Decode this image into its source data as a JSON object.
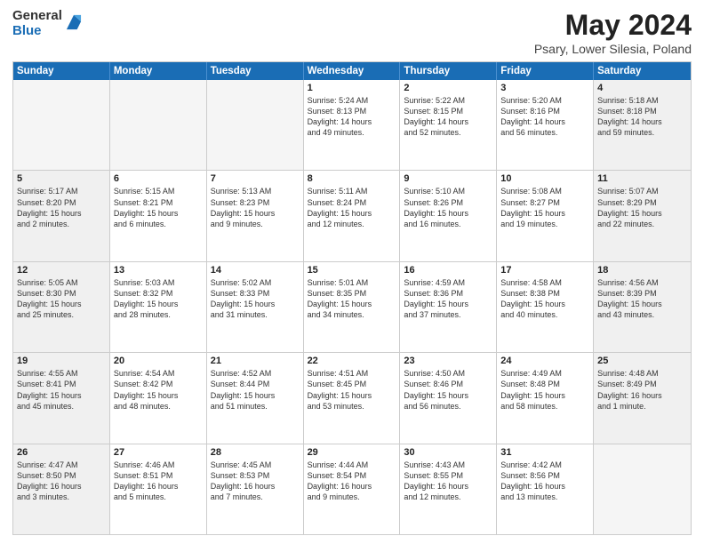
{
  "header": {
    "logo_general": "General",
    "logo_blue": "Blue",
    "title": "May 2024",
    "location": "Psary, Lower Silesia, Poland"
  },
  "days_of_week": [
    "Sunday",
    "Monday",
    "Tuesday",
    "Wednesday",
    "Thursday",
    "Friday",
    "Saturday"
  ],
  "weeks": [
    [
      {
        "day": "",
        "info": ""
      },
      {
        "day": "",
        "info": ""
      },
      {
        "day": "",
        "info": ""
      },
      {
        "day": "1",
        "info": "Sunrise: 5:24 AM\nSunset: 8:13 PM\nDaylight: 14 hours\nand 49 minutes."
      },
      {
        "day": "2",
        "info": "Sunrise: 5:22 AM\nSunset: 8:15 PM\nDaylight: 14 hours\nand 52 minutes."
      },
      {
        "day": "3",
        "info": "Sunrise: 5:20 AM\nSunset: 8:16 PM\nDaylight: 14 hours\nand 56 minutes."
      },
      {
        "day": "4",
        "info": "Sunrise: 5:18 AM\nSunset: 8:18 PM\nDaylight: 14 hours\nand 59 minutes."
      }
    ],
    [
      {
        "day": "5",
        "info": "Sunrise: 5:17 AM\nSunset: 8:20 PM\nDaylight: 15 hours\nand 2 minutes."
      },
      {
        "day": "6",
        "info": "Sunrise: 5:15 AM\nSunset: 8:21 PM\nDaylight: 15 hours\nand 6 minutes."
      },
      {
        "day": "7",
        "info": "Sunrise: 5:13 AM\nSunset: 8:23 PM\nDaylight: 15 hours\nand 9 minutes."
      },
      {
        "day": "8",
        "info": "Sunrise: 5:11 AM\nSunset: 8:24 PM\nDaylight: 15 hours\nand 12 minutes."
      },
      {
        "day": "9",
        "info": "Sunrise: 5:10 AM\nSunset: 8:26 PM\nDaylight: 15 hours\nand 16 minutes."
      },
      {
        "day": "10",
        "info": "Sunrise: 5:08 AM\nSunset: 8:27 PM\nDaylight: 15 hours\nand 19 minutes."
      },
      {
        "day": "11",
        "info": "Sunrise: 5:07 AM\nSunset: 8:29 PM\nDaylight: 15 hours\nand 22 minutes."
      }
    ],
    [
      {
        "day": "12",
        "info": "Sunrise: 5:05 AM\nSunset: 8:30 PM\nDaylight: 15 hours\nand 25 minutes."
      },
      {
        "day": "13",
        "info": "Sunrise: 5:03 AM\nSunset: 8:32 PM\nDaylight: 15 hours\nand 28 minutes."
      },
      {
        "day": "14",
        "info": "Sunrise: 5:02 AM\nSunset: 8:33 PM\nDaylight: 15 hours\nand 31 minutes."
      },
      {
        "day": "15",
        "info": "Sunrise: 5:01 AM\nSunset: 8:35 PM\nDaylight: 15 hours\nand 34 minutes."
      },
      {
        "day": "16",
        "info": "Sunrise: 4:59 AM\nSunset: 8:36 PM\nDaylight: 15 hours\nand 37 minutes."
      },
      {
        "day": "17",
        "info": "Sunrise: 4:58 AM\nSunset: 8:38 PM\nDaylight: 15 hours\nand 40 minutes."
      },
      {
        "day": "18",
        "info": "Sunrise: 4:56 AM\nSunset: 8:39 PM\nDaylight: 15 hours\nand 43 minutes."
      }
    ],
    [
      {
        "day": "19",
        "info": "Sunrise: 4:55 AM\nSunset: 8:41 PM\nDaylight: 15 hours\nand 45 minutes."
      },
      {
        "day": "20",
        "info": "Sunrise: 4:54 AM\nSunset: 8:42 PM\nDaylight: 15 hours\nand 48 minutes."
      },
      {
        "day": "21",
        "info": "Sunrise: 4:52 AM\nSunset: 8:44 PM\nDaylight: 15 hours\nand 51 minutes."
      },
      {
        "day": "22",
        "info": "Sunrise: 4:51 AM\nSunset: 8:45 PM\nDaylight: 15 hours\nand 53 minutes."
      },
      {
        "day": "23",
        "info": "Sunrise: 4:50 AM\nSunset: 8:46 PM\nDaylight: 15 hours\nand 56 minutes."
      },
      {
        "day": "24",
        "info": "Sunrise: 4:49 AM\nSunset: 8:48 PM\nDaylight: 15 hours\nand 58 minutes."
      },
      {
        "day": "25",
        "info": "Sunrise: 4:48 AM\nSunset: 8:49 PM\nDaylight: 16 hours\nand 1 minute."
      }
    ],
    [
      {
        "day": "26",
        "info": "Sunrise: 4:47 AM\nSunset: 8:50 PM\nDaylight: 16 hours\nand 3 minutes."
      },
      {
        "day": "27",
        "info": "Sunrise: 4:46 AM\nSunset: 8:51 PM\nDaylight: 16 hours\nand 5 minutes."
      },
      {
        "day": "28",
        "info": "Sunrise: 4:45 AM\nSunset: 8:53 PM\nDaylight: 16 hours\nand 7 minutes."
      },
      {
        "day": "29",
        "info": "Sunrise: 4:44 AM\nSunset: 8:54 PM\nDaylight: 16 hours\nand 9 minutes."
      },
      {
        "day": "30",
        "info": "Sunrise: 4:43 AM\nSunset: 8:55 PM\nDaylight: 16 hours\nand 12 minutes."
      },
      {
        "day": "31",
        "info": "Sunrise: 4:42 AM\nSunset: 8:56 PM\nDaylight: 16 hours\nand 13 minutes."
      },
      {
        "day": "",
        "info": ""
      }
    ]
  ]
}
